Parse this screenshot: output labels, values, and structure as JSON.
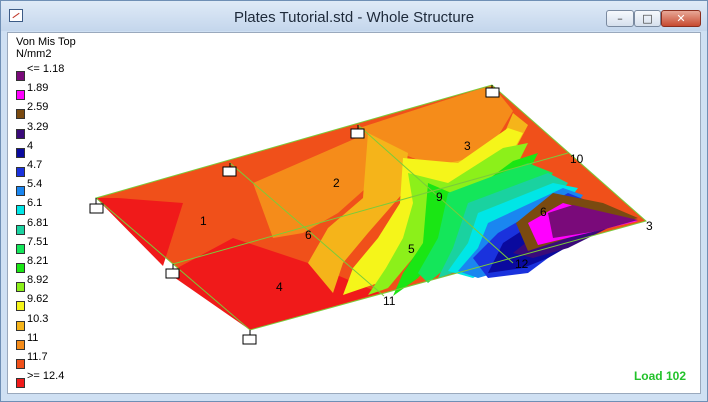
{
  "window": {
    "title": "Plates Tutorial.std - Whole Structure"
  },
  "controls": {
    "minimize": "–",
    "maximize": "□",
    "close": "✕"
  },
  "legend": {
    "title": "Von Mis Top",
    "unit": "N/mm2",
    "entries": [
      {
        "label": "<= 1.18",
        "color": "#7a0a7a"
      },
      {
        "label": "1.89",
        "color": "#ff00ff"
      },
      {
        "label": "2.59",
        "color": "#7a4a10"
      },
      {
        "label": "3.29",
        "color": "#3a0a7a"
      },
      {
        "label": "4",
        "color": "#0a0a9e"
      },
      {
        "label": "4.7",
        "color": "#1a32dd"
      },
      {
        "label": "5.4",
        "color": "#1a86f0"
      },
      {
        "label": "6.1",
        "color": "#00e6e6"
      },
      {
        "label": "6.81",
        "color": "#1ad2a0"
      },
      {
        "label": "7.51",
        "color": "#14e65a"
      },
      {
        "label": "8.21",
        "color": "#1ae614"
      },
      {
        "label": "8.92",
        "color": "#8cf01a"
      },
      {
        "label": "9.62",
        "color": "#f5f51a"
      },
      {
        "label": "10.3",
        "color": "#f5b41a"
      },
      {
        "label": "11",
        "color": "#f58c1a"
      },
      {
        "label": "11.7",
        "color": "#f0501a"
      },
      {
        "label": ">= 12.4",
        "color": "#f01a1a"
      }
    ]
  },
  "model": {
    "plate_labels": [
      "1",
      "2",
      "3",
      "4",
      "5",
      "6"
    ],
    "node_labels": [
      "6",
      "9",
      "10",
      "11",
      "12",
      "3"
    ]
  },
  "load_label": "Load 102"
}
